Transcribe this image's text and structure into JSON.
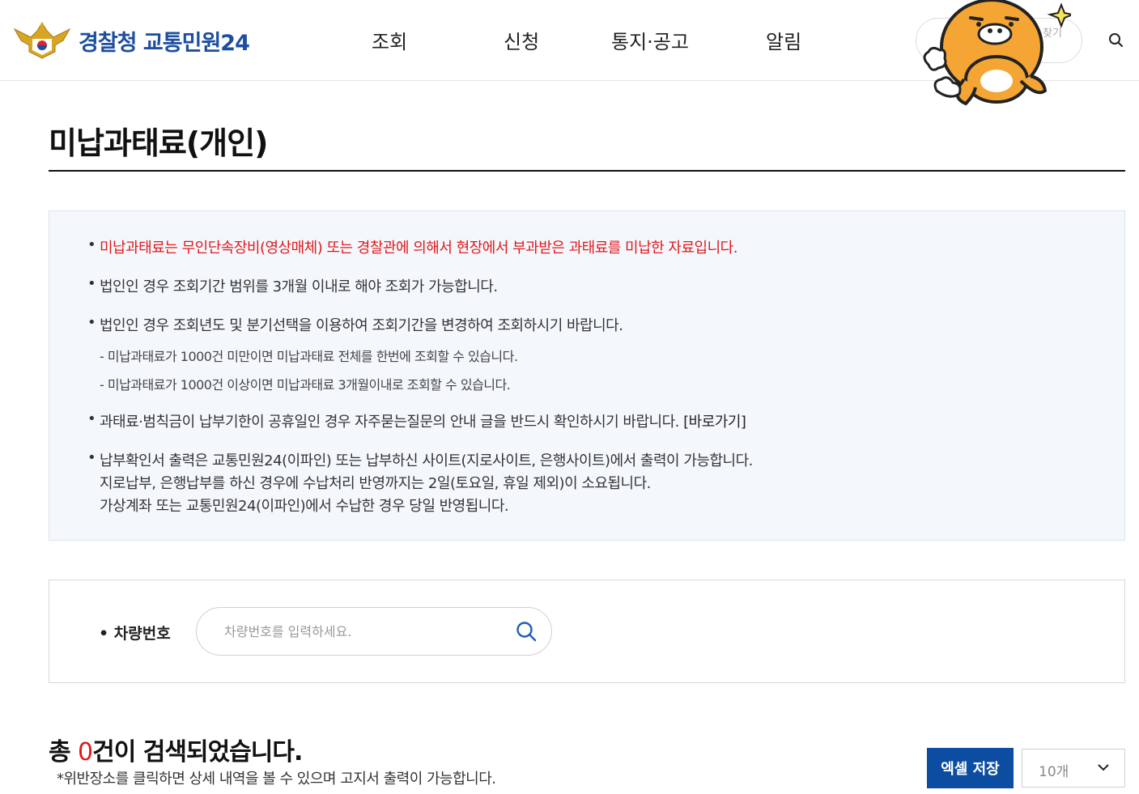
{
  "header": {
    "logo_text": "경찰청 교통민원24",
    "nav": [
      "조회",
      "신청",
      "통지·공고",
      "알림"
    ],
    "search_label": "찾기",
    "colors": {
      "brand": "#1d4fa0",
      "accent": "#e0191c"
    }
  },
  "page": {
    "title": "미납과태료(개인)"
  },
  "info": {
    "lines": [
      "미납과태료는 무인단속장비(영상매체) 또는 경찰관에 의해서 현장에서 부과받은 과태료를 미납한 자료입니다.",
      "법인인 경우 조회기간 범위를 3개월 이내로 해야 조회가 가능합니다.",
      "법인인 경우 조회년도 및 분기선택을 이용하여 조회기간을 변경하여 조회하시기 바랍니다."
    ],
    "sub_lines": [
      "- 미납과태료가 1000건 미만이면 미납과태료 전체를 한번에 조회할 수 있습니다.",
      "- 미납과태료가 1000건 이상이면 미납과태료 3개월이내로 조회할 수 있습니다."
    ],
    "holiday_line": "과태료·범칙금이 납부기한이 공휴일인 경우 자주묻는질문의 안내 글을 반드시 확인하시기 바랍니다.",
    "holiday_link": "[바로가기]",
    "receipt_lines": [
      "납부확인서 출력은 교통민원24(이파인) 또는 납부하신 사이트(지로사이트, 은행사이트)에서 출력이 가능합니다.",
      "지로납부, 은행납부를 하신 경우에 수납처리 반영까지는 2일(토요일, 휴일 제외)이 소요됩니다.",
      "가상계좌 또는 교통민원24(이파인)에서 수납한 경우 당일 반영됩니다."
    ]
  },
  "search": {
    "label": "• 차량번호",
    "placeholder": "차량번호를 입력하세요."
  },
  "result": {
    "prefix": "총 ",
    "count": "0",
    "suffix": "건이 검색되었습니다.",
    "note": "*위반장소를 클릭하면 상세 내역을 볼 수 있으며 고지서 출력이 가능합니다.",
    "excel_button": "엑셀 저장",
    "page_size": "10개"
  }
}
